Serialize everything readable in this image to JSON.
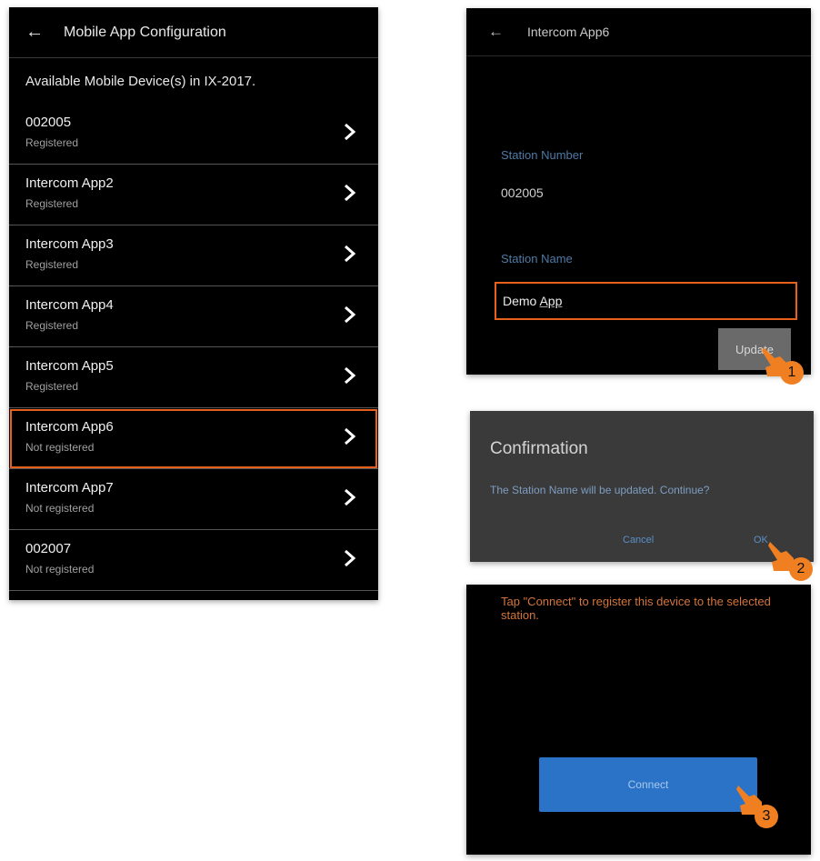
{
  "left": {
    "title": "Mobile App Configuration",
    "subtitle": "Available Mobile Device(s) in IX-2017.",
    "items": [
      {
        "name": "002005",
        "status": "Registered"
      },
      {
        "name": "Intercom App2",
        "status": "Registered"
      },
      {
        "name": "Intercom App3",
        "status": "Registered"
      },
      {
        "name": "Intercom App4",
        "status": "Registered"
      },
      {
        "name": "Intercom App5",
        "status": "Registered"
      },
      {
        "name": "Intercom App6",
        "status": "Not registered"
      },
      {
        "name": "Intercom App7",
        "status": "Not registered"
      },
      {
        "name": "002007",
        "status": "Not registered"
      }
    ]
  },
  "station": {
    "title": "Intercom App6",
    "number_label": "Station Number",
    "number_value": "002005",
    "name_label": "Station Name",
    "name_value_prefix": "Demo ",
    "name_value_underlined": "App",
    "update_label": "Update"
  },
  "confirmation": {
    "title": "Confirmation",
    "message": "The Station Name will be updated. Continue?",
    "cancel_label": "Cancel",
    "ok_label": "OK"
  },
  "connect": {
    "tip": "Tap \"Connect\" to register this device to the selected station.",
    "button_label": "Connect"
  },
  "steps": [
    "1",
    "2",
    "3"
  ],
  "colors": {
    "highlight": "#e8611c",
    "badge": "#f07f22",
    "accent_blue": "#2a73c6"
  }
}
